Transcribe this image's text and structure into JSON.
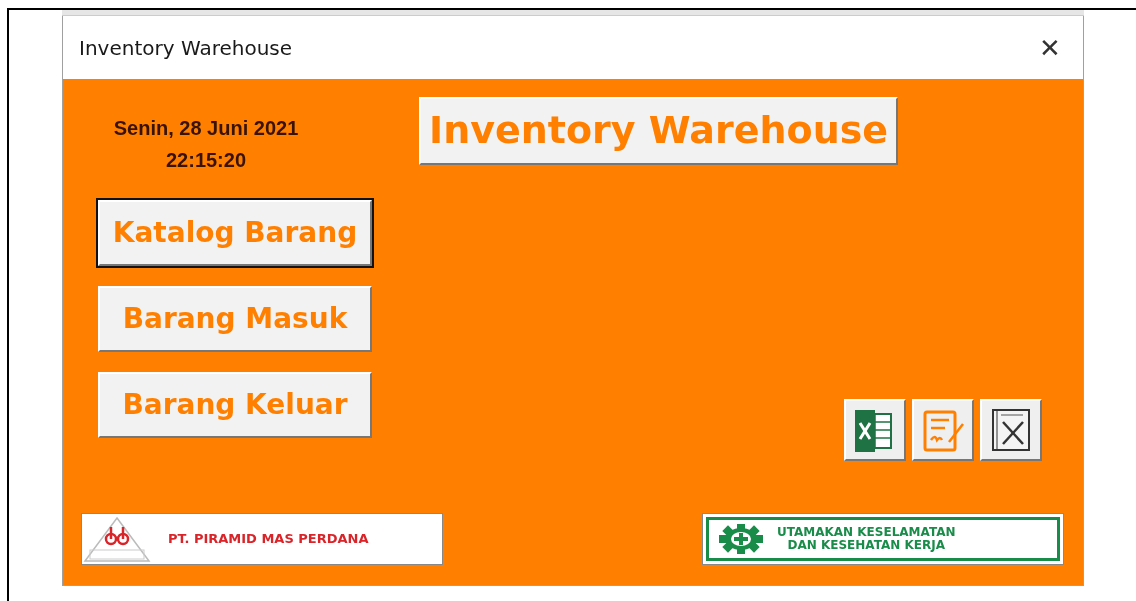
{
  "window": {
    "title": "Inventory Warehouse",
    "close": "✕"
  },
  "clock": {
    "date": "Senin, 28 Juni 2021",
    "time": "22:15:20"
  },
  "heading": "Inventory Warehouse",
  "menu_buttons": [
    {
      "label": "Katalog Barang",
      "focused": true
    },
    {
      "label": "Barang Masuk",
      "focused": false
    },
    {
      "label": "Barang Keluar",
      "focused": false
    }
  ],
  "tool_buttons": [
    {
      "kind": "spreadsheet"
    },
    {
      "kind": "form"
    },
    {
      "kind": "manual"
    }
  ],
  "company_logo": {
    "name": "PT. PIRAMID MAS PERDANA"
  },
  "safety_banner": {
    "lines": [
      "UTAMAKAN KESELAMATAN",
      "DAN KESEHATAN KERJA"
    ]
  }
}
